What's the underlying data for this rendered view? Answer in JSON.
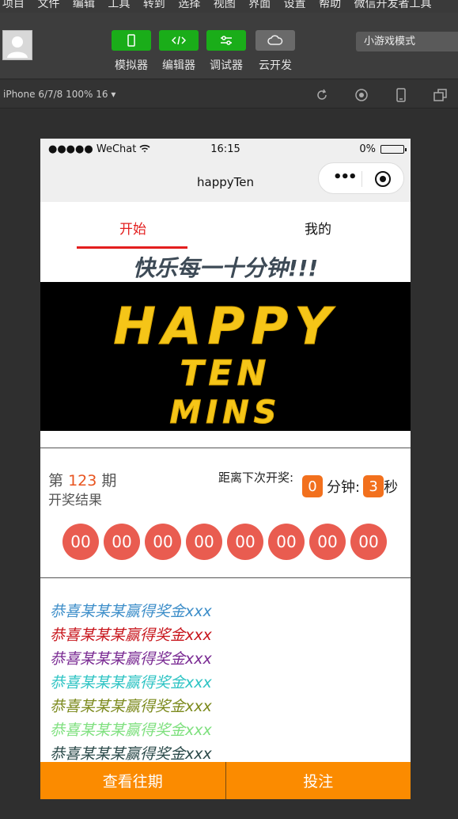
{
  "menu": [
    "项目",
    "文件",
    "编辑",
    "工具",
    "转到",
    "选择",
    "视图",
    "界面",
    "设置",
    "帮助",
    "微信开发者工具"
  ],
  "toolbar": {
    "simulator": "模拟器",
    "editor": "编辑器",
    "debugger": "调试器",
    "cloud": "云开发",
    "mode": "小游戏模式"
  },
  "device_bar": {
    "device": "iPhone 6/7/8 100% 16 ▾"
  },
  "status": {
    "carrier": "●●●●● WeChat",
    "time": "16:15",
    "battery": "0%"
  },
  "nav": {
    "title": "happyTen"
  },
  "tabs": {
    "start": "开始",
    "mine": "我的"
  },
  "slogan": "快乐每一十分钟!!!",
  "banner": {
    "line1": "HAPPY",
    "line2": "TEN",
    "line3": "MINS"
  },
  "draw": {
    "period_prefix": "第",
    "period_number": "123",
    "period_suffix": "期",
    "result_label": "开奖结果",
    "next_label": "距离下次开奖:",
    "minutes": "0",
    "minutes_unit": "分钟:",
    "seconds": "3",
    "seconds_unit": "秒",
    "numbers": [
      "00",
      "00",
      "00",
      "00",
      "00",
      "00",
      "00",
      "00"
    ]
  },
  "winners": [
    {
      "text": "恭喜某某某赢得奖金xxx",
      "color": "#3d8ec9"
    },
    {
      "text": "恭喜某某某赢得奖金xxx",
      "color": "#c8161d"
    },
    {
      "text": "恭喜某某某赢得奖金xxx",
      "color": "#7a2b93"
    },
    {
      "text": "恭喜某某某赢得奖金xxx",
      "color": "#2fc4c4"
    },
    {
      "text": "恭喜某某某赢得奖金xxx",
      "color": "#7c8a1d"
    },
    {
      "text": "恭喜某某某赢得奖金xxx",
      "color": "#7fe07f"
    },
    {
      "text": "恭喜某某某赢得奖金xxx",
      "color": "#2b4a4a"
    }
  ],
  "actions": {
    "history": "查看往期",
    "bet": "投注"
  }
}
